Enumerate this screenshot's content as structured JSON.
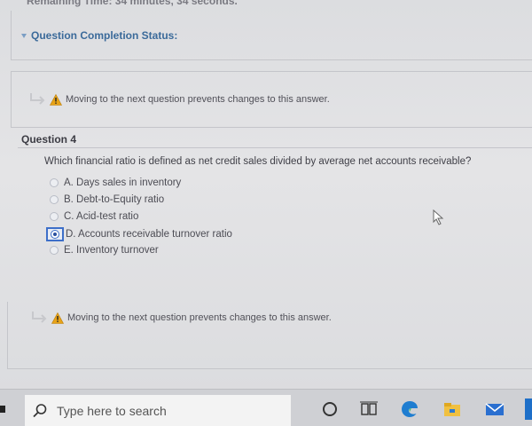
{
  "header": {
    "remaining_time_text": "Remaining Time: 34 minutes, 34 seconds."
  },
  "status": {
    "label": "Question Completion Status:"
  },
  "warnings": {
    "first": "Moving to the next question prevents changes to this answer.",
    "second": "Moving to the next question prevents changes to this answer."
  },
  "question": {
    "title": "Question 4",
    "text": "Which financial ratio is defined as net credit sales divided by average net accounts receivable?",
    "options": [
      {
        "label": "A. Days sales in inventory",
        "selected": false
      },
      {
        "label": "B. Debt-to-Equity ratio",
        "selected": false
      },
      {
        "label": "C. Acid-test ratio",
        "selected": false
      },
      {
        "label": "D. Accounts receivable turnover ratio",
        "selected": true
      },
      {
        "label": "E. Inventory turnover",
        "selected": false
      }
    ]
  },
  "taskbar": {
    "search_placeholder": "Type here to search",
    "icons": [
      "cortana-icon",
      "task-view-icon",
      "edge-icon",
      "file-explorer-icon",
      "mail-icon"
    ]
  },
  "colors": {
    "accent": "#3d6fc9",
    "status_text": "#3b6a9a",
    "warning": "#e8a317"
  }
}
